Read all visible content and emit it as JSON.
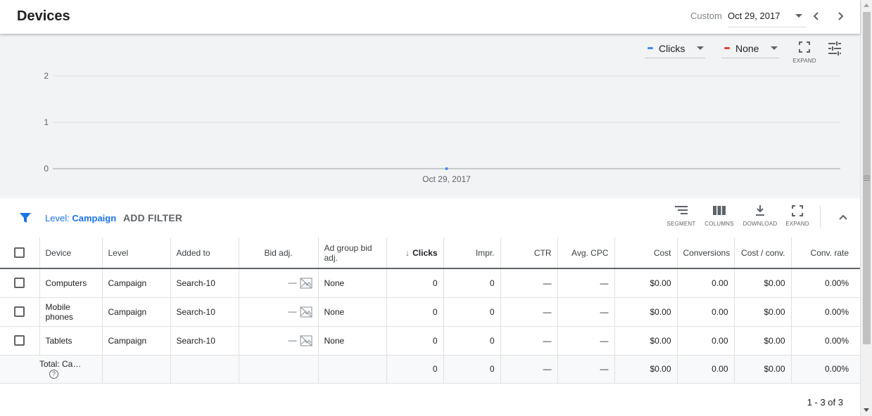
{
  "header": {
    "title": "Devices",
    "date_range_label": "Custom",
    "date_value": "Oct 29, 2017"
  },
  "chart_controls": {
    "metric1": {
      "label": "Clicks",
      "color": "#4285f4"
    },
    "metric2": {
      "label": "None",
      "color": "#db4437"
    },
    "expand_label": "EXPAND"
  },
  "chart_data": {
    "type": "line",
    "series": [
      {
        "name": "Clicks",
        "color": "#4285f4",
        "x": [
          "Oct 29, 2017"
        ],
        "values": [
          0
        ]
      }
    ],
    "x_tick_labels": [
      "Oct 29, 2017"
    ],
    "y_tick_labels": [
      "0",
      "1",
      "2"
    ],
    "ylim": [
      0,
      2
    ],
    "grid": true
  },
  "filter_bar": {
    "level_prefix": "Level:",
    "level_value": "Campaign",
    "add_filter_label": "ADD FILTER",
    "segment_label": "SEGMENT",
    "columns_label": "COLUMNS",
    "download_label": "DOWNLOAD",
    "expand_label": "EXPAND"
  },
  "table": {
    "headers": {
      "device": "Device",
      "level": "Level",
      "added_to": "Added to",
      "bid_adj": "Bid adj.",
      "ad_group_bid_adj": "Ad group bid adj.",
      "clicks": "Clicks",
      "impr": "Impr.",
      "ctr": "CTR",
      "avg_cpc": "Avg. CPC",
      "cost": "Cost",
      "conversions": "Conversions",
      "cost_conv": "Cost / conv.",
      "conv_rate": "Conv. rate"
    },
    "rows": [
      {
        "device": "Computers",
        "level": "Campaign",
        "added_to": "Search-10",
        "bid_adj": "—",
        "ad_group_bid_adj": "None",
        "clicks": "0",
        "impr": "0",
        "ctr": "—",
        "avg_cpc": "—",
        "cost": "$0.00",
        "conversions": "0.00",
        "cost_conv": "$0.00",
        "conv_rate": "0.00%"
      },
      {
        "device": "Mobile phones",
        "level": "Campaign",
        "added_to": "Search-10",
        "bid_adj": "—",
        "ad_group_bid_adj": "None",
        "clicks": "0",
        "impr": "0",
        "ctr": "—",
        "avg_cpc": "—",
        "cost": "$0.00",
        "conversions": "0.00",
        "cost_conv": "$0.00",
        "conv_rate": "0.00%"
      },
      {
        "device": "Tablets",
        "level": "Campaign",
        "added_to": "Search-10",
        "bid_adj": "—",
        "ad_group_bid_adj": "None",
        "clicks": "0",
        "impr": "0",
        "ctr": "—",
        "avg_cpc": "—",
        "cost": "$0.00",
        "conversions": "0.00",
        "cost_conv": "$0.00",
        "conv_rate": "0.00%"
      }
    ],
    "total": {
      "label": "Total: Ca…",
      "clicks": "0",
      "impr": "0",
      "ctr": "—",
      "avg_cpc": "—",
      "cost": "$0.00",
      "conversions": "0.00",
      "cost_conv": "$0.00",
      "conv_rate": "0.00%"
    }
  },
  "pagination": {
    "text": "1 - 3 of 3"
  }
}
